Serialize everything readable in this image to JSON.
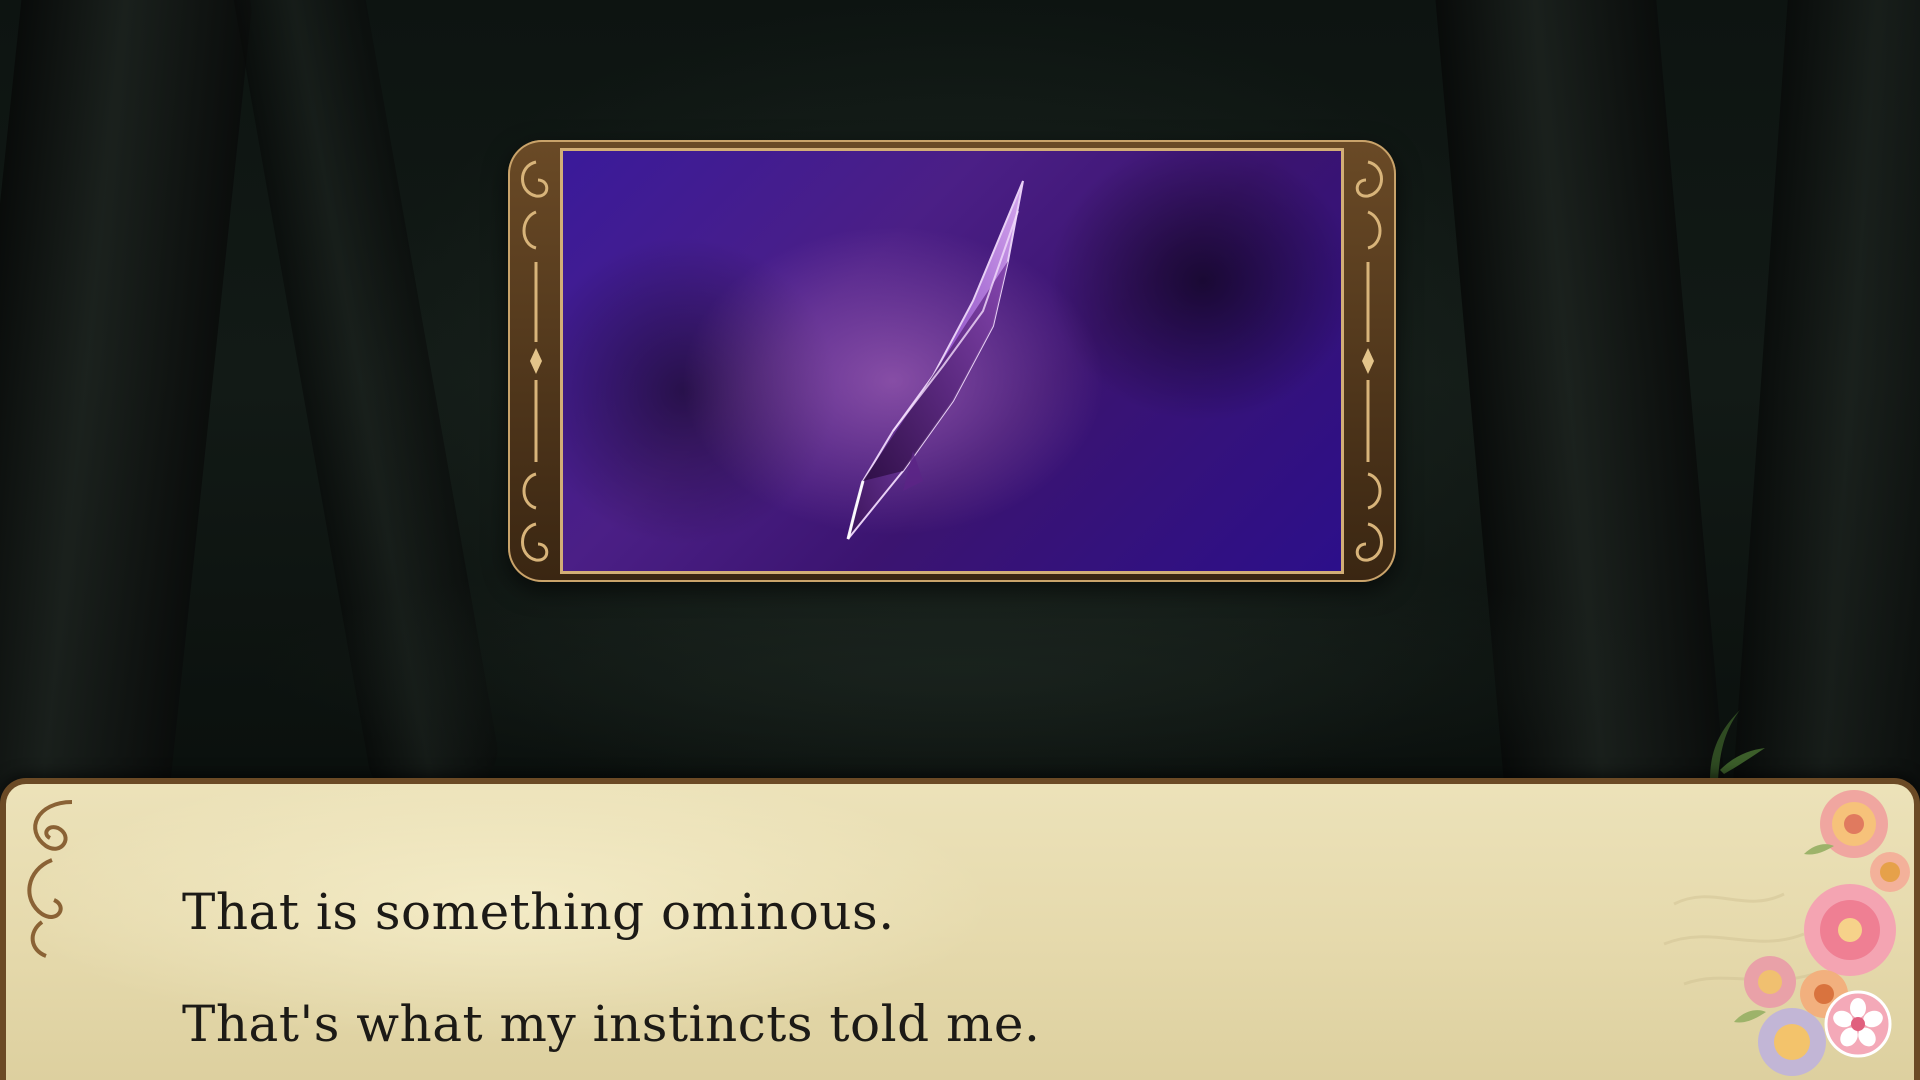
{
  "scene": {
    "background": "dark-forest",
    "colors": {
      "frame_gold": "#c9a36a",
      "crystal_purple": "#7c3fb0",
      "dialogue_paper": "#e8ddb2",
      "dialogue_text": "#1c1a16",
      "blossom_pink": "#f2a3b6"
    }
  },
  "item_display": {
    "item_icon": "purple-crystal-shard-icon"
  },
  "dialogue": {
    "lines": [
      "That is something ominous.",
      "That's what my instincts told me."
    ],
    "advance_icon": "cherry-blossom-icon"
  }
}
